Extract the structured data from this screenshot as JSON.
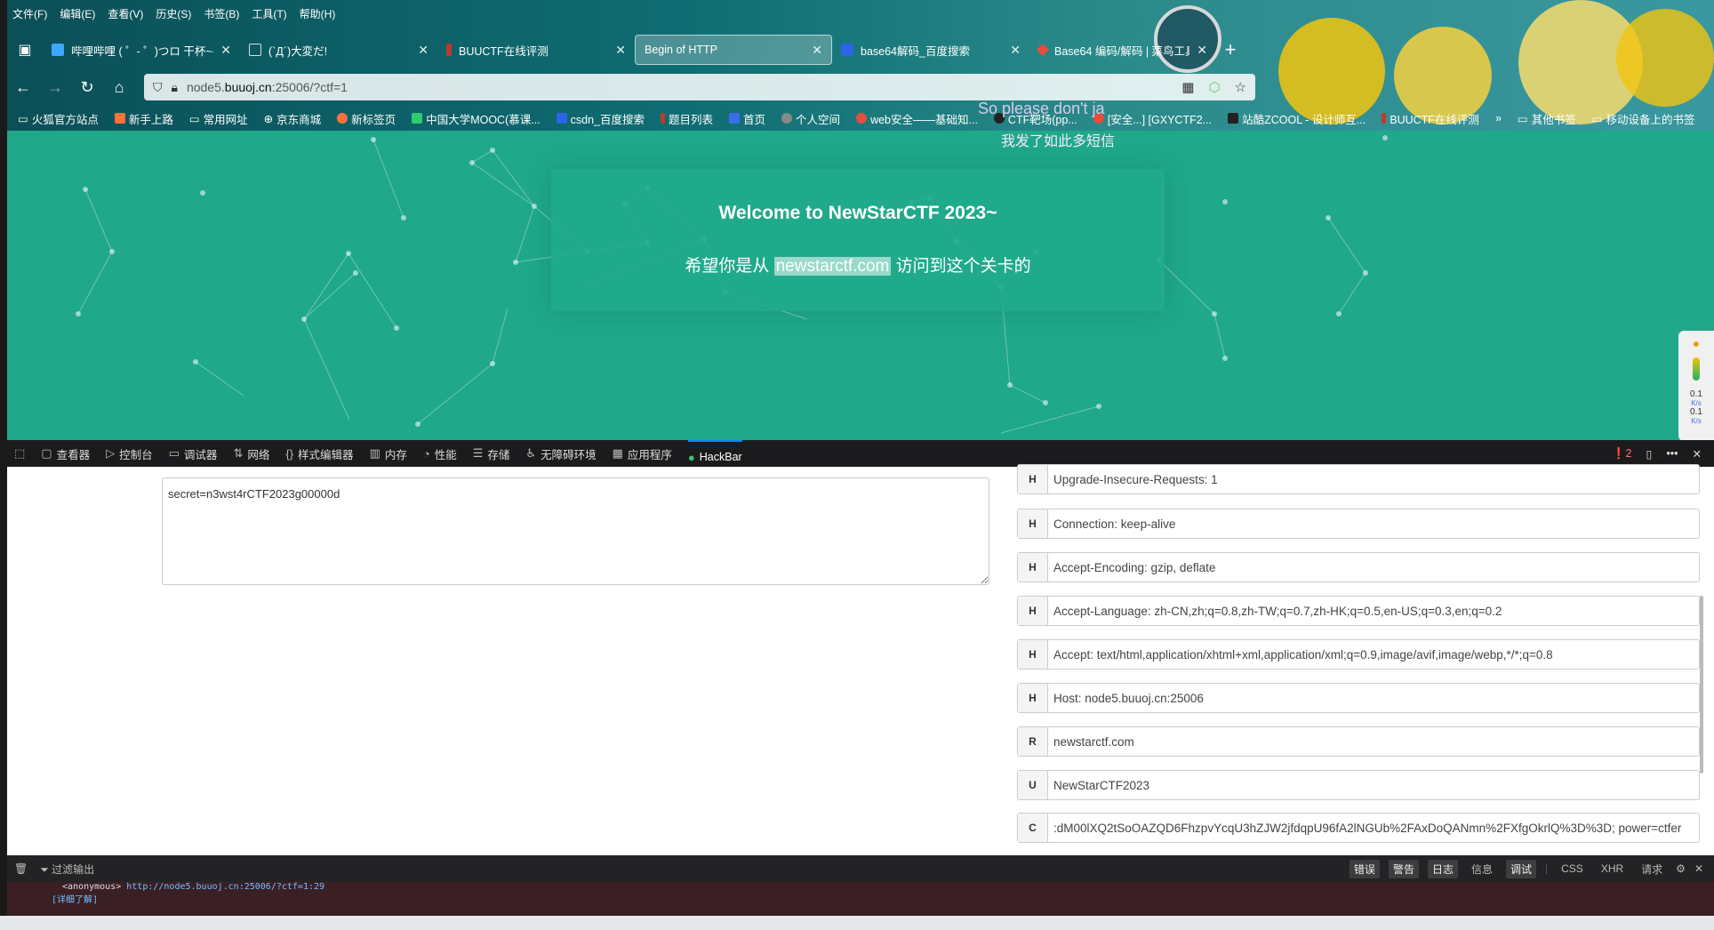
{
  "menu": [
    "文件(F)",
    "编辑(E)",
    "查看(V)",
    "历史(S)",
    "书签(B)",
    "工具(T)",
    "帮助(H)"
  ],
  "tabs": [
    {
      "label": "哔哩哔哩 ( ゜- ゜)つロ 干杯~-bi",
      "color": "#3ea6ff"
    },
    {
      "label": "(`Д´)大変だ!",
      "color": "#cccccc"
    },
    {
      "label": "BUUCTF在线评测",
      "color": "#c0392b"
    },
    {
      "label": "Begin of HTTP",
      "color": "",
      "active": true
    },
    {
      "label": "base64解码_百度搜索",
      "color": "#2d64e6"
    },
    {
      "label": "Base64 编码/解码 | 菜鸟工具",
      "color": "#e74c3c"
    }
  ],
  "url": {
    "prefix": "node5.",
    "host": "buuoj.cn",
    "rest": ":25006/?ctf=1"
  },
  "bookmarks": [
    "火狐官方站点",
    "新手上路",
    "常用网址",
    "京东商城",
    "新标签页",
    "中国大学MOOC(慕课...",
    "csdn_百度搜索",
    "题目列表",
    "首页",
    "个人空间",
    "web安全——基础知...",
    "CTF靶场(pp...",
    "[安全...] [GXYCTF2...",
    "站酷ZCOOL - 设计师互...",
    "BUUCTF在线评测",
    "其他书签",
    "移动设备上的书签"
  ],
  "overlay": {
    "line1": "So please don't ja",
    "line2": "我发了如此多短信"
  },
  "page": {
    "title": "Welcome to NewStarCTF 2023~",
    "sub_before": "希望你是从 ",
    "sub_highlight": "newstarctf.com",
    "sub_after": " 访问到这个关卡的"
  },
  "meter": {
    "v1": "0.1",
    "u1": "K/s",
    "v2": "0.1",
    "u2": "K/s"
  },
  "devtools": {
    "tabs": [
      "查看器",
      "控制台",
      "调试器",
      "网络",
      "样式编辑器",
      "内存",
      "性能",
      "存储",
      "无障碍环境",
      "应用程序",
      "HackBar"
    ],
    "active": "HackBar",
    "error_count": "2"
  },
  "hackbar": {
    "post_body": "secret=n3wst4rCTF2023g00000d",
    "headers": [
      {
        "k": "H",
        "v": "Upgrade-Insecure-Requests: 1"
      },
      {
        "k": "H",
        "v": "Connection: keep-alive"
      },
      {
        "k": "H",
        "v": "Accept-Encoding: gzip, deflate"
      },
      {
        "k": "H",
        "v": "Accept-Language: zh-CN,zh;q=0.8,zh-TW;q=0.7,zh-HK;q=0.5,en-US;q=0.3,en;q=0.2"
      },
      {
        "k": "H",
        "v": "Accept: text/html,application/xhtml+xml,application/xml;q=0.9,image/avif,image/webp,*/*;q=0.8"
      },
      {
        "k": "H",
        "v": "Host: node5.buuoj.cn:25006"
      },
      {
        "k": "R",
        "v": "newstarctf.com"
      },
      {
        "k": "U",
        "v": "NewStarCTF2023"
      },
      {
        "k": "C",
        "v": ":dM00lXQ2tSoOAZQD6FhzpvYcqU3hZJW2jfdqpU96fA2lNGUb%2FAxDoQANmn%2FXfgOkrlQ%3D%3D; power=ctfer"
      }
    ]
  },
  "console": {
    "filter_label": "过滤输出",
    "filters": [
      "错误",
      "警告",
      "日志",
      "信息",
      "调试",
      "CSS",
      "XHR",
      "请求"
    ],
    "line1_prefix": "<anonymous>",
    "line1_link": "http://node5.buuoj.cn:25006/?ctf=1:29",
    "line2": "[详细了解]"
  }
}
